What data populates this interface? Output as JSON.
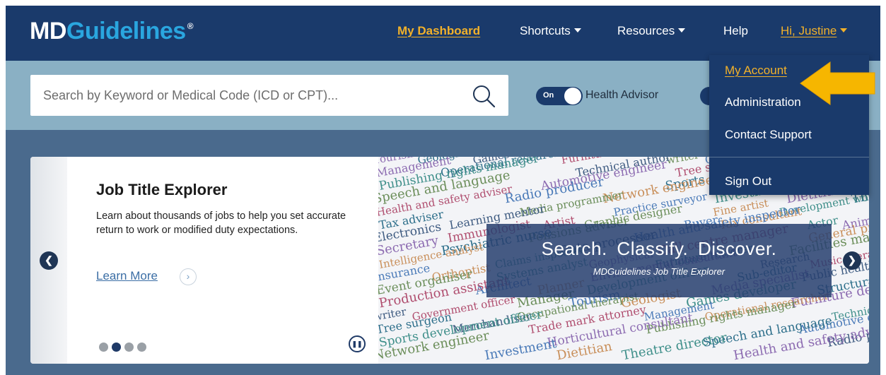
{
  "brand": {
    "logo_md": "MD",
    "logo_guidelines": "Guidelines",
    "logo_mark": "®"
  },
  "nav": {
    "dashboard": "My Dashboard",
    "shortcuts": "Shortcuts",
    "resources": "Resources",
    "help": "Help",
    "user": "Hi, Justine"
  },
  "search": {
    "placeholder": "Search by Keyword or Medical Code (ICD or CPT)..."
  },
  "toggles": {
    "health_advisor_state": "On",
    "health_advisor_label": "Health Advisor"
  },
  "user_menu": {
    "items": [
      "My Account",
      "Administration",
      "Contact Support",
      "Sign Out"
    ]
  },
  "carousel": {
    "title": "Job Title Explorer",
    "description": "Learn about thousands of jobs to help you set accurate return to work or modified duty expectations.",
    "learn_more": "Learn More",
    "overlay_title": "Search.  Classify.  Discover.",
    "overlay_subtitle": "MDGuidelines Job Title Explorer",
    "slide_count": 4,
    "active_slide": 2
  },
  "wordcloud": {
    "words": [
      "Tourism",
      "Geologist",
      "Games developer",
      "Furniture designer",
      "writer",
      "Government officer",
      "Occupational therapist",
      "Management",
      "Operational researcher",
      "Technical author",
      "Tree surgeon",
      "Merchandiser",
      "Trade mark attorney",
      "Publishing rights manager",
      "Automotive engineer",
      "Sports development officer",
      "Horticultural consultant",
      "Speech and language",
      "Radio producer",
      "Network engineer",
      "Investment",
      "Dietitian",
      "Theatre director",
      "Health and safety adviser",
      "Media programmer",
      "Practice surveyor",
      "Fine artist",
      "Development worker",
      "Tax adviser",
      "Learning mentor",
      "Artist",
      "Graphic designer",
      "Buyer",
      "Tax consultant",
      "Actor",
      "Animator",
      "Electronics",
      "Immunologist",
      "Pensions adviser",
      "Health and safety inspector",
      "General practice",
      "Secretary",
      "Psychiatric nurse",
      "Data processor",
      "Call centre manager",
      "Facilities manager",
      "Intelligence analyst",
      "Claims inspector",
      "Geophysical",
      "Furniture restorer",
      "Research",
      "Music therapist",
      "Insurance",
      "Orthoptist",
      "Systems analyst",
      "Environmental consultant",
      "Sub-editor",
      "Public health",
      "Event organiser",
      "Architect",
      "Planner",
      "Development officer",
      "Media specialist",
      "Structural engineer",
      "Production assistant",
      "Manager"
    ]
  },
  "colors": {
    "nav_bg": "#1a3a6b",
    "accent": "#f2b12a",
    "search_band": "#8ab0c4",
    "page_bg": "#4a6a8d",
    "brand_blue": "#2aa6df"
  },
  "icons": [
    "search-icon",
    "chevron-left-icon",
    "chevron-right-icon",
    "pause-icon",
    "caret-down-icon",
    "arrow-pointer"
  ]
}
